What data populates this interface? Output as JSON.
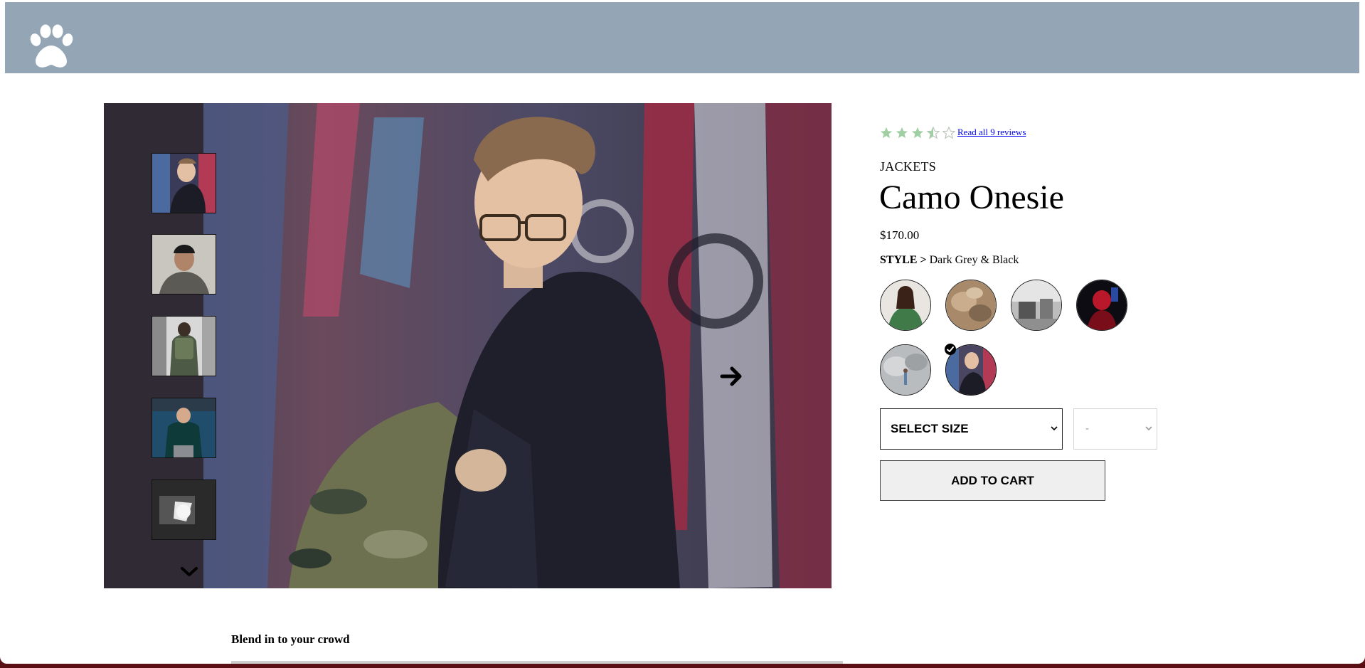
{
  "header": {
    "logo_icon": "paw-icon",
    "background": "#94a6b5"
  },
  "gallery": {
    "main_image": "person-in-black-hoodie-against-graffiti-wall",
    "thumbnails": [
      "man-with-glasses-graffiti",
      "man-in-beanie",
      "person-with-backpack-street",
      "man-in-dark-sweater",
      "dark-abstract-photo"
    ],
    "scroll_down_icon": "chevron-down-icon",
    "next_icon": "arrow-right-icon"
  },
  "product": {
    "rating": 3.5,
    "rating_max": 5,
    "reviews_link": "Read all 9 reviews",
    "category": "JACKETS",
    "title": "Camo Onesie",
    "price": "$170.00",
    "style_label": "STYLE >",
    "style_value": "Dark Grey & Black",
    "styles": [
      {
        "name": "woman-in-green-jacket",
        "selected": false
      },
      {
        "name": "tan-textured",
        "selected": false
      },
      {
        "name": "street-grey",
        "selected": false
      },
      {
        "name": "red-and-black",
        "selected": false
      },
      {
        "name": "grey-outdoor",
        "selected": false
      },
      {
        "name": "dark-grey-and-black",
        "selected": true
      }
    ],
    "size_select": "SELECT SIZE",
    "quantity_select": "-",
    "add_to_cart": "ADD TO CART"
  },
  "description": {
    "heading": "Blend in to your crowd"
  },
  "colors": {
    "star_filled": "#9fcfa3",
    "star_empty": "#b9c6b9",
    "link": "#0000ee"
  }
}
